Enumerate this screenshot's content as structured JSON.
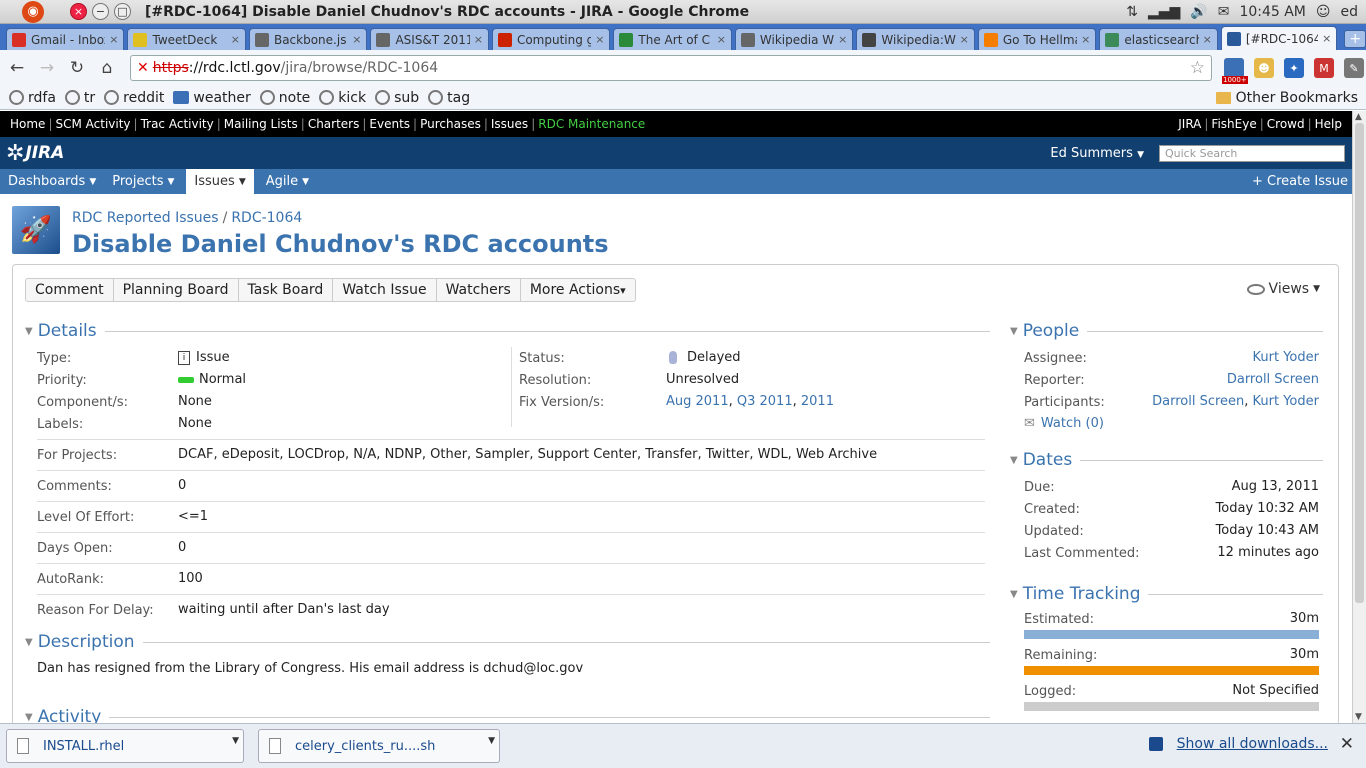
{
  "os": {
    "window_title": "[#RDC-1064] Disable Daniel Chudnov's RDC accounts - JIRA - Google Chrome",
    "clock": "10:45 AM",
    "user": "ed"
  },
  "tabs": [
    {
      "title": "Gmail - Inbox",
      "icon": "gmail-icon",
      "color": "#d93025"
    },
    {
      "title": "TweetDeck",
      "icon": "tweetdeck-icon",
      "color": "#e0c020"
    },
    {
      "title": "Backbone.js",
      "icon": "globe-icon",
      "color": "#666666"
    },
    {
      "title": "ASIS&T 2011",
      "icon": "globe-icon",
      "color": "#666666"
    },
    {
      "title": "Computing g",
      "icon": "oreilly-icon",
      "color": "#cc2200"
    },
    {
      "title": "The Art of C",
      "icon": "book-icon",
      "color": "#2a8a3a"
    },
    {
      "title": "Wikipedia W",
      "icon": "globe-icon",
      "color": "#666666"
    },
    {
      "title": "Wikipedia:Wi",
      "icon": "wikipedia-icon",
      "color": "#444444"
    },
    {
      "title": "Go To Hellma",
      "icon": "blogger-icon",
      "color": "#f57d00"
    },
    {
      "title": "elasticsearch",
      "icon": "elasticsearch-icon",
      "color": "#3a8a5a"
    },
    {
      "title": "[#RDC-1064",
      "icon": "jira-icon",
      "color": "#2a5a9a",
      "active": true
    }
  ],
  "address": {
    "scheme": "https",
    "host": "://rdc.lctl.gov",
    "path": "/jira/browse/RDC-1064",
    "feed_badge": "1000+"
  },
  "bookmarks": [
    {
      "label": "rdfa"
    },
    {
      "label": "tr"
    },
    {
      "label": "reddit"
    },
    {
      "label": "weather",
      "weather": true
    },
    {
      "label": "note"
    },
    {
      "label": "kick"
    },
    {
      "label": "sub"
    },
    {
      "label": "tag"
    }
  ],
  "other_bookmarks": "Other Bookmarks",
  "jira": {
    "topnav": [
      "Home",
      "SCM Activity",
      "Trac Activity",
      "Mailing Lists",
      "Charters",
      "Events",
      "Purchases",
      "Issues"
    ],
    "topnav_highlight": "RDC Maintenance",
    "topnav_right": [
      "JIRA",
      "FishEye",
      "Crowd",
      "Help"
    ],
    "logo": "JIRA",
    "user_name": "Ed Summers",
    "quick_search_placeholder": "Quick Search",
    "menus": [
      "Dashboards",
      "Projects",
      "Issues",
      "Agile"
    ],
    "create_issue": "Create Issue",
    "breadcrumb_project": "RDC Reported Issues",
    "breadcrumb_key": "RDC-1064",
    "summary": "Disable Daniel Chudnov's RDC accounts",
    "ops": [
      "Comment",
      "Planning Board",
      "Task Board",
      "Watch Issue",
      "Watchers",
      "More Actions"
    ],
    "views": "Views"
  },
  "details": {
    "heading": "Details",
    "type_label": "Type:",
    "type": "Issue",
    "priority_label": "Priority:",
    "priority": "Normal",
    "priority_color": "#33cc33",
    "component_label": "Component/s:",
    "component": "None",
    "labels_label": "Labels:",
    "labels": "None",
    "status_label": "Status:",
    "status": "Delayed",
    "resolution_label": "Resolution:",
    "resolution": "Unresolved",
    "fixversion_label": "Fix Version/s:",
    "fix_versions": [
      "Aug 2011",
      "Q3 2011",
      "2011"
    ],
    "for_projects_label": "For Projects:",
    "for_projects": "DCAF, eDeposit, LOCDrop, N/A, NDNP, Other, Sampler, Support Center, Transfer, Twitter, WDL, Web Archive",
    "comments_label": "Comments:",
    "comments": "0",
    "effort_label": "Level Of Effort:",
    "effort": "<=1",
    "days_open_label": "Days Open:",
    "days_open": "0",
    "autorank_label": "AutoRank:",
    "autorank": "100",
    "delay_label": "Reason For Delay:",
    "delay": "waiting until after Dan's last day"
  },
  "description": {
    "heading": "Description",
    "text": "Dan has resigned from the Library of Congress. His email address is dchud@loc.gov"
  },
  "activity_heading": "Activity",
  "people": {
    "heading": "People",
    "assignee_label": "Assignee:",
    "assignee": "Kurt Yoder",
    "reporter_label": "Reporter:",
    "reporter": "Darroll Screen",
    "participants_label": "Participants:",
    "participants": [
      "Darroll Screen",
      "Kurt Yoder"
    ],
    "watch": "Watch (0)"
  },
  "dates": {
    "heading": "Dates",
    "due_label": "Due:",
    "due": "Aug 13, 2011",
    "created_label": "Created:",
    "created": "Today 10:32 AM",
    "updated_label": "Updated:",
    "updated": "Today 10:43 AM",
    "last_commented_label": "Last Commented:",
    "last_commented": "12 minutes ago"
  },
  "time_tracking": {
    "heading": "Time Tracking",
    "estimated_label": "Estimated:",
    "estimated": "30m",
    "estimated_fraction": 1.0,
    "estimated_color": "#89afd7",
    "remaining_label": "Remaining:",
    "remaining": "30m",
    "remaining_fraction": 1.0,
    "remaining_color": "#f09000",
    "logged_label": "Logged:",
    "logged": "Not Specified",
    "logged_fraction": 0.0,
    "logged_color": "#cccccc"
  },
  "downloads": {
    "items": [
      "INSTALL.rhel",
      "celery_clients_ru....sh"
    ],
    "show_all": "Show all downloads..."
  }
}
